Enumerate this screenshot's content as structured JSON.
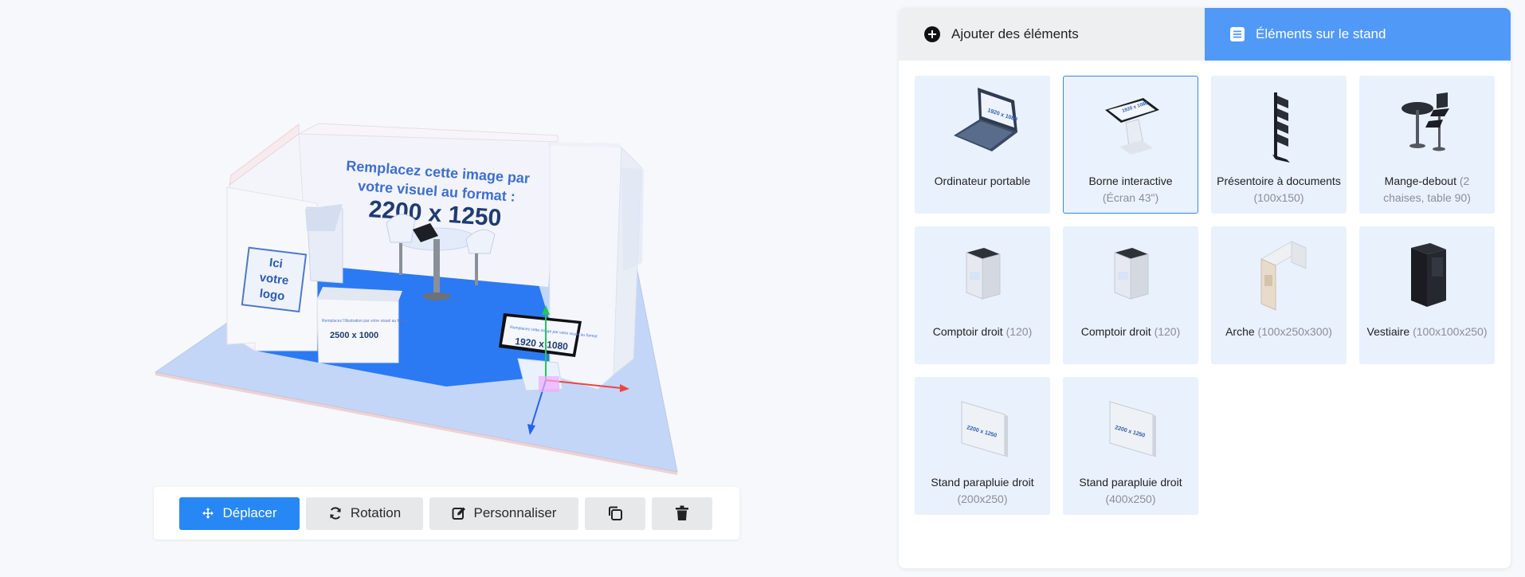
{
  "viewport": {
    "back_wall_text": [
      "Remplacez cette image par",
      "votre visuel au format :",
      "2200 x 1250"
    ],
    "logo_text": [
      "Ici",
      "votre",
      "logo"
    ],
    "counter_text": "2500 x 1000",
    "counter_small_text": "Remplacez l'illustration par votre visuel au format",
    "kiosk_text": "1920 x 1080",
    "kiosk_small_text": "Remplacez cette image par votre visuel au format"
  },
  "toolbar": {
    "move_label": "Déplacer",
    "rotate_label": "Rotation",
    "customize_label": "Personnaliser"
  },
  "panel": {
    "tab_add": "Ajouter des éléments",
    "tab_stand": "Éléments sur le stand",
    "items": [
      {
        "name": "Ordinateur portable",
        "detail": "",
        "thumb": "laptop",
        "selected": false,
        "screen_text": "1920 x 1080"
      },
      {
        "name": "Borne interactive",
        "detail": "(Écran 43\")",
        "thumb": "kiosk",
        "selected": true,
        "screen_text": "1920 x 1080"
      },
      {
        "name": "Présentoire à documents",
        "detail": "(100x150)",
        "thumb": "brochure-rack",
        "selected": false
      },
      {
        "name": "Mange-debout",
        "detail": "(2 chaises, table 90)",
        "thumb": "bar-table",
        "selected": false
      },
      {
        "name": "Comptoir droit",
        "detail": "(120)",
        "thumb": "counter",
        "selected": false
      },
      {
        "name": "Comptoir droit",
        "detail": "(120)",
        "thumb": "counter",
        "selected": false
      },
      {
        "name": "Arche",
        "detail": "(100x250x300)",
        "thumb": "arch",
        "selected": false
      },
      {
        "name": "Vestiaire",
        "detail": "(100x100x250)",
        "thumb": "cloakroom",
        "selected": false
      },
      {
        "name": "Stand parapluie droit",
        "detail": "(200x250)",
        "thumb": "popup-wall",
        "selected": false,
        "screen_text": "2200 x 1250"
      },
      {
        "name": "Stand parapluie droit",
        "detail": "(400x250)",
        "thumb": "popup-wall",
        "selected": false,
        "screen_text": "2200 x 1250"
      }
    ]
  },
  "colors": {
    "accent": "#2787f5",
    "tab_active": "#5199f7",
    "card_bg": "#e9f1fd",
    "floor_blue": "#2b7af3"
  }
}
